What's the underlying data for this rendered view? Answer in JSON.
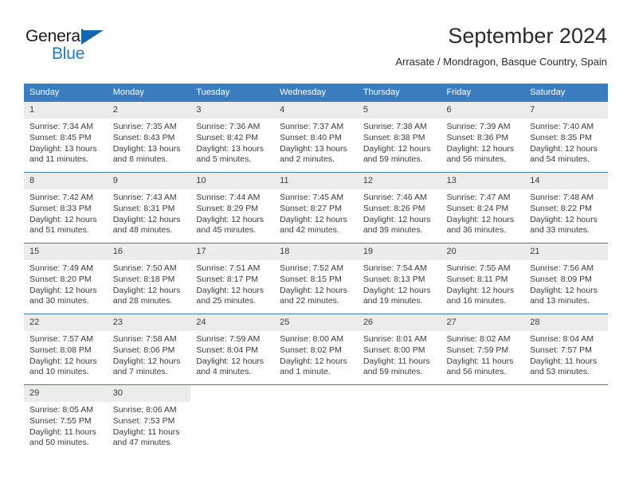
{
  "logo": {
    "word_top": "General",
    "word_bottom": "Blue",
    "triangle_color": "#1565b0",
    "blue_color": "#1f7ac4"
  },
  "header": {
    "title": "September 2024",
    "subtitle": "Arrasate / Mondragon, Basque Country, Spain"
  },
  "colors": {
    "header_row_bg": "#3b7cbf",
    "header_row_text": "#ffffff",
    "daynum_bg": "#ececec",
    "week_divider": "#3b7cbf",
    "body_text": "#3a3a3a"
  },
  "weekdays": [
    "Sunday",
    "Monday",
    "Tuesday",
    "Wednesday",
    "Thursday",
    "Friday",
    "Saturday"
  ],
  "weeks": [
    [
      {
        "day": "1",
        "sunrise": "Sunrise: 7:34 AM",
        "sunset": "Sunset: 8:45 PM",
        "daylight1": "Daylight: 13 hours",
        "daylight2": "and 11 minutes."
      },
      {
        "day": "2",
        "sunrise": "Sunrise: 7:35 AM",
        "sunset": "Sunset: 8:43 PM",
        "daylight1": "Daylight: 13 hours",
        "daylight2": "and 8 minutes."
      },
      {
        "day": "3",
        "sunrise": "Sunrise: 7:36 AM",
        "sunset": "Sunset: 8:42 PM",
        "daylight1": "Daylight: 13 hours",
        "daylight2": "and 5 minutes."
      },
      {
        "day": "4",
        "sunrise": "Sunrise: 7:37 AM",
        "sunset": "Sunset: 8:40 PM",
        "daylight1": "Daylight: 13 hours",
        "daylight2": "and 2 minutes."
      },
      {
        "day": "5",
        "sunrise": "Sunrise: 7:38 AM",
        "sunset": "Sunset: 8:38 PM",
        "daylight1": "Daylight: 12 hours",
        "daylight2": "and 59 minutes."
      },
      {
        "day": "6",
        "sunrise": "Sunrise: 7:39 AM",
        "sunset": "Sunset: 8:36 PM",
        "daylight1": "Daylight: 12 hours",
        "daylight2": "and 56 minutes."
      },
      {
        "day": "7",
        "sunrise": "Sunrise: 7:40 AM",
        "sunset": "Sunset: 8:35 PM",
        "daylight1": "Daylight: 12 hours",
        "daylight2": "and 54 minutes."
      }
    ],
    [
      {
        "day": "8",
        "sunrise": "Sunrise: 7:42 AM",
        "sunset": "Sunset: 8:33 PM",
        "daylight1": "Daylight: 12 hours",
        "daylight2": "and 51 minutes."
      },
      {
        "day": "9",
        "sunrise": "Sunrise: 7:43 AM",
        "sunset": "Sunset: 8:31 PM",
        "daylight1": "Daylight: 12 hours",
        "daylight2": "and 48 minutes."
      },
      {
        "day": "10",
        "sunrise": "Sunrise: 7:44 AM",
        "sunset": "Sunset: 8:29 PM",
        "daylight1": "Daylight: 12 hours",
        "daylight2": "and 45 minutes."
      },
      {
        "day": "11",
        "sunrise": "Sunrise: 7:45 AM",
        "sunset": "Sunset: 8:27 PM",
        "daylight1": "Daylight: 12 hours",
        "daylight2": "and 42 minutes."
      },
      {
        "day": "12",
        "sunrise": "Sunrise: 7:46 AM",
        "sunset": "Sunset: 8:26 PM",
        "daylight1": "Daylight: 12 hours",
        "daylight2": "and 39 minutes."
      },
      {
        "day": "13",
        "sunrise": "Sunrise: 7:47 AM",
        "sunset": "Sunset: 8:24 PM",
        "daylight1": "Daylight: 12 hours",
        "daylight2": "and 36 minutes."
      },
      {
        "day": "14",
        "sunrise": "Sunrise: 7:48 AM",
        "sunset": "Sunset: 8:22 PM",
        "daylight1": "Daylight: 12 hours",
        "daylight2": "and 33 minutes."
      }
    ],
    [
      {
        "day": "15",
        "sunrise": "Sunrise: 7:49 AM",
        "sunset": "Sunset: 8:20 PM",
        "daylight1": "Daylight: 12 hours",
        "daylight2": "and 30 minutes."
      },
      {
        "day": "16",
        "sunrise": "Sunrise: 7:50 AM",
        "sunset": "Sunset: 8:18 PM",
        "daylight1": "Daylight: 12 hours",
        "daylight2": "and 28 minutes."
      },
      {
        "day": "17",
        "sunrise": "Sunrise: 7:51 AM",
        "sunset": "Sunset: 8:17 PM",
        "daylight1": "Daylight: 12 hours",
        "daylight2": "and 25 minutes."
      },
      {
        "day": "18",
        "sunrise": "Sunrise: 7:52 AM",
        "sunset": "Sunset: 8:15 PM",
        "daylight1": "Daylight: 12 hours",
        "daylight2": "and 22 minutes."
      },
      {
        "day": "19",
        "sunrise": "Sunrise: 7:54 AM",
        "sunset": "Sunset: 8:13 PM",
        "daylight1": "Daylight: 12 hours",
        "daylight2": "and 19 minutes."
      },
      {
        "day": "20",
        "sunrise": "Sunrise: 7:55 AM",
        "sunset": "Sunset: 8:11 PM",
        "daylight1": "Daylight: 12 hours",
        "daylight2": "and 16 minutes."
      },
      {
        "day": "21",
        "sunrise": "Sunrise: 7:56 AM",
        "sunset": "Sunset: 8:09 PM",
        "daylight1": "Daylight: 12 hours",
        "daylight2": "and 13 minutes."
      }
    ],
    [
      {
        "day": "22",
        "sunrise": "Sunrise: 7:57 AM",
        "sunset": "Sunset: 8:08 PM",
        "daylight1": "Daylight: 12 hours",
        "daylight2": "and 10 minutes."
      },
      {
        "day": "23",
        "sunrise": "Sunrise: 7:58 AM",
        "sunset": "Sunset: 8:06 PM",
        "daylight1": "Daylight: 12 hours",
        "daylight2": "and 7 minutes."
      },
      {
        "day": "24",
        "sunrise": "Sunrise: 7:59 AM",
        "sunset": "Sunset: 8:04 PM",
        "daylight1": "Daylight: 12 hours",
        "daylight2": "and 4 minutes."
      },
      {
        "day": "25",
        "sunrise": "Sunrise: 8:00 AM",
        "sunset": "Sunset: 8:02 PM",
        "daylight1": "Daylight: 12 hours",
        "daylight2": "and 1 minute."
      },
      {
        "day": "26",
        "sunrise": "Sunrise: 8:01 AM",
        "sunset": "Sunset: 8:00 PM",
        "daylight1": "Daylight: 11 hours",
        "daylight2": "and 59 minutes."
      },
      {
        "day": "27",
        "sunrise": "Sunrise: 8:02 AM",
        "sunset": "Sunset: 7:59 PM",
        "daylight1": "Daylight: 11 hours",
        "daylight2": "and 56 minutes."
      },
      {
        "day": "28",
        "sunrise": "Sunrise: 8:04 AM",
        "sunset": "Sunset: 7:57 PM",
        "daylight1": "Daylight: 11 hours",
        "daylight2": "and 53 minutes."
      }
    ],
    [
      {
        "day": "29",
        "sunrise": "Sunrise: 8:05 AM",
        "sunset": "Sunset: 7:55 PM",
        "daylight1": "Daylight: 11 hours",
        "daylight2": "and 50 minutes."
      },
      {
        "day": "30",
        "sunrise": "Sunrise: 8:06 AM",
        "sunset": "Sunset: 7:53 PM",
        "daylight1": "Daylight: 11 hours",
        "daylight2": "and 47 minutes."
      },
      {
        "day": "",
        "sunrise": "",
        "sunset": "",
        "daylight1": "",
        "daylight2": ""
      },
      {
        "day": "",
        "sunrise": "",
        "sunset": "",
        "daylight1": "",
        "daylight2": ""
      },
      {
        "day": "",
        "sunrise": "",
        "sunset": "",
        "daylight1": "",
        "daylight2": ""
      },
      {
        "day": "",
        "sunrise": "",
        "sunset": "",
        "daylight1": "",
        "daylight2": ""
      },
      {
        "day": "",
        "sunrise": "",
        "sunset": "",
        "daylight1": "",
        "daylight2": ""
      }
    ]
  ]
}
